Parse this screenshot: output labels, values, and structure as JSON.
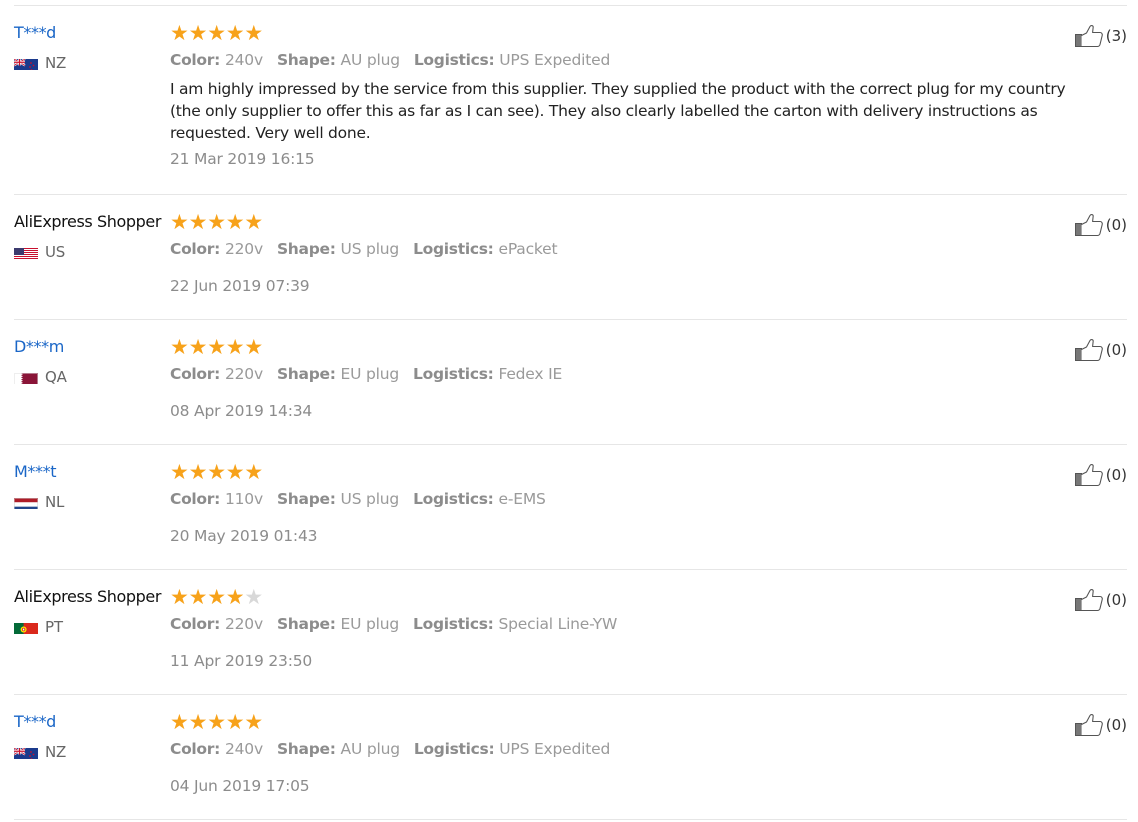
{
  "labels": {
    "color": "Color:",
    "shape": "Shape:",
    "logistics": "Logistics:"
  },
  "colors": {
    "username_link": "#1a66c7",
    "star_filled": "#f7a21a",
    "star_empty": "#d8d8d8",
    "meta_text": "#9a9a9a"
  },
  "reviews": [
    {
      "user": "T***d",
      "user_style": "link",
      "country": "NZ",
      "flag": "nz",
      "rating": 5,
      "color": "240v",
      "shape": "AU plug",
      "logistics": "UPS Expedited",
      "text": "I am highly impressed by the service from this supplier. They supplied the product with the correct plug for my country (the only supplier to offer this as far as I can see). They also clearly labelled the carton with delivery instructions as requested. Very well done.",
      "date": "21 Mar 2019 16:15",
      "helpful_count": "(3)"
    },
    {
      "user": "AliExpress Shopper",
      "user_style": "plain",
      "country": "US",
      "flag": "us",
      "rating": 5,
      "color": "220v",
      "shape": "US plug",
      "logistics": "ePacket",
      "text": "",
      "date": "22 Jun 2019 07:39",
      "helpful_count": "(0)"
    },
    {
      "user": "D***m",
      "user_style": "link",
      "country": "QA",
      "flag": "qa",
      "rating": 5,
      "color": "220v",
      "shape": "EU plug",
      "logistics": "Fedex IE",
      "text": "",
      "date": "08 Apr 2019 14:34",
      "helpful_count": "(0)"
    },
    {
      "user": "M***t",
      "user_style": "link",
      "country": "NL",
      "flag": "nl",
      "rating": 5,
      "color": "110v",
      "shape": "US plug",
      "logistics": "e-EMS",
      "text": "",
      "date": "20 May 2019 01:43",
      "helpful_count": "(0)"
    },
    {
      "user": "AliExpress Shopper",
      "user_style": "plain",
      "country": "PT",
      "flag": "pt",
      "rating": 4,
      "color": "220v",
      "shape": "EU plug",
      "logistics": "Special Line-YW",
      "text": "",
      "date": "11 Apr 2019 23:50",
      "helpful_count": "(0)"
    },
    {
      "user": "T***d",
      "user_style": "link",
      "country": "NZ",
      "flag": "nz",
      "rating": 5,
      "color": "240v",
      "shape": "AU plug",
      "logistics": "UPS Expedited",
      "text": "",
      "date": "04 Jun 2019 17:05",
      "helpful_count": "(0)"
    }
  ]
}
